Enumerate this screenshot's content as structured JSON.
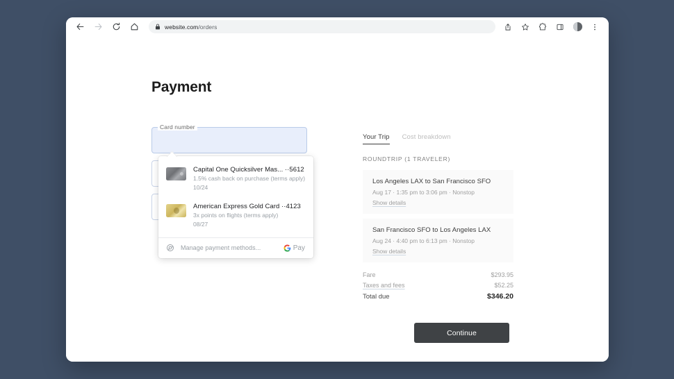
{
  "browser": {
    "back_icon": "back-arrow-icon",
    "forward_icon": "forward-arrow-icon",
    "reload_icon": "reload-icon",
    "home_icon": "home-icon",
    "lock_icon": "lock-icon",
    "url_domain": "website.com",
    "url_path": "/orders",
    "share_icon": "share-icon",
    "bookmark_icon": "star-icon",
    "extensions_icon": "puzzle-icon",
    "panel_icon": "side-panel-icon",
    "avatar_icon": "profile-avatar",
    "menu_icon": "three-dot-menu-icon"
  },
  "page": {
    "title": "Payment"
  },
  "form": {
    "card_number_label": "Card number",
    "card_number_value": "",
    "field2_value": "",
    "field3_value": ""
  },
  "autofill": {
    "items": [
      {
        "title": "Capital One Quicksilver Mas...",
        "last4": "··5612",
        "benefit": "1.5% cash back on purchase (terms apply)",
        "expiry": "10/24",
        "card_art": "silver-card-icon"
      },
      {
        "title": "American Express Gold Card",
        "last4": "··4123",
        "benefit": "3x points on flights (terms apply)",
        "expiry": "08/27",
        "card_art": "gold-card-icon"
      }
    ],
    "manage_label": "Manage payment methods...",
    "settings_icon": "chrome-settings-icon",
    "gpay_label": "Pay",
    "gpay_icon": "google-g-icon"
  },
  "summary": {
    "tabs": [
      {
        "label": "Your Trip",
        "active": true
      },
      {
        "label": "Cost breakdown",
        "active": false
      }
    ],
    "section_head": "ROUNDTRIP (1 TRAVELER)",
    "trips": [
      {
        "route": "Los Angeles LAX to San Francisco SFO",
        "meta": "Aug 17 · 1:35 pm to 3:06 pm · Nonstop",
        "link": "Show details"
      },
      {
        "route": "San Francisco SFO to Los Angeles LAX",
        "meta": "Aug 24 · 4:40 pm to 6:13 pm · Nonstop",
        "link": "Show details"
      }
    ],
    "prices": [
      {
        "label": "Fare",
        "value": "$293.95"
      },
      {
        "label": "Taxes and fees",
        "value": "$52.25"
      }
    ],
    "total_label": "Total due",
    "total_value": "$346.20"
  },
  "actions": {
    "continue_label": "Continue"
  },
  "colors": {
    "desktop_bg": "#3f4f66",
    "button_bg": "#3f4245",
    "autofill_field_bg": "#e8eefb",
    "accent_link": "#9e9e9e"
  }
}
